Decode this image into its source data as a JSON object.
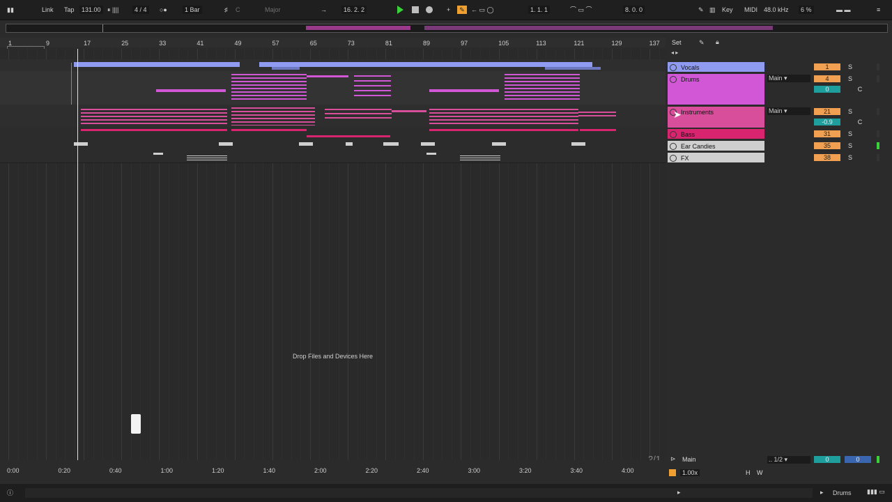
{
  "transport": {
    "link": "Link",
    "tap": "Tap",
    "tempo": "131.00",
    "time_signature": "4 / 4",
    "quantize": "1 Bar",
    "key_root": "C",
    "scale": "Major",
    "position": "16.  2.  2",
    "loop_start": "1.  1.  1",
    "loop_length": "8.  0.  0",
    "key_label": "Key",
    "midi_label": "MIDI",
    "sample_rate": "48.0 kHz",
    "cpu": "6 %"
  },
  "ruler": {
    "bars": [
      "1",
      "9",
      "17",
      "25",
      "33",
      "41",
      "49",
      "57",
      "65",
      "73",
      "81",
      "89",
      "97",
      "105",
      "113",
      "121",
      "129",
      "137"
    ]
  },
  "time_ruler": {
    "times": [
      "0:00",
      "0:20",
      "0:40",
      "1:00",
      "1:20",
      "1:40",
      "2:00",
      "2:20",
      "2:40",
      "3:00",
      "3:20",
      "3:40",
      "4:00"
    ]
  },
  "arrangement": {
    "drop_hint": "Drop Files and Devices Here",
    "zoom_ratio": "2/1"
  },
  "set_label": "Set",
  "tracks": [
    {
      "name": "Vocals",
      "color": "#8e9bf0",
      "number": "1",
      "solo": "S"
    },
    {
      "name": "Drums",
      "color": "#d257d6",
      "number": "4",
      "solo": "S",
      "output": "Main",
      "volume": "0",
      "pan": "C"
    },
    {
      "name": "Instruments",
      "color": "#d94e9a",
      "number": "21",
      "solo": "S",
      "output": "Main",
      "volume": "-0.9",
      "pan": "C"
    },
    {
      "name": "Bass",
      "color": "#d9246f",
      "number": "31",
      "solo": "S"
    },
    {
      "name": "Ear Candies",
      "color": "#cfcfcf",
      "number": "35",
      "solo": "S"
    },
    {
      "name": "FX",
      "color": "#cfcfcf",
      "number": "38",
      "solo": "S"
    }
  ],
  "main_track": {
    "name": "Main",
    "output": ".. 1/2",
    "volume": "0",
    "pan": "0",
    "h": "H",
    "w": "W",
    "speed": "1.00x"
  },
  "status": {
    "selected_track": "Drums"
  }
}
